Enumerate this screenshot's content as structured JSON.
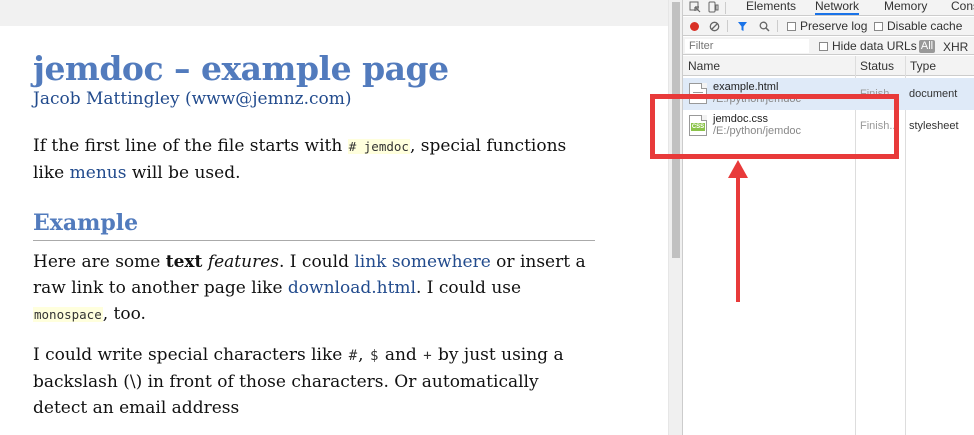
{
  "page": {
    "title": "jemdoc – example page",
    "author": "Jacob Mattingley",
    "author_email_open": "(",
    "author_email": "www@jemnz.com",
    "author_email_close": ")",
    "intro": {
      "t1": "If the first line of the file starts with ",
      "code": "# jemdoc",
      "t2": ", special functions",
      "t3": "like ",
      "link": "menus",
      "t4": " will be used."
    },
    "section_heading": "Example",
    "para1": {
      "t1": "Here are some ",
      "bold": "text",
      "t2": " ",
      "italic": "features",
      "t3": ". I could ",
      "link1": "link somewhere",
      "t4": " or insert a",
      "t5": "raw link to another page like ",
      "link2": "download.html",
      "t6": ". I could use",
      "code": "monospace",
      "t7": ", too."
    },
    "para2": {
      "line1a": "I could write special characters like ",
      "c1": "#",
      "sep1": ", ",
      "c2": "$",
      "sep2": " and ",
      "c3": "+",
      "line1b": " by just using a",
      "line2": "backslash (\\) in front of those characters. Or automatically",
      "line3": "detect an email address"
    }
  },
  "devtools": {
    "tabs": [
      "Elements",
      "Network",
      "Memory",
      "Cons"
    ],
    "active_tab": "Network",
    "toolbar": {
      "preserve_log": "Preserve log",
      "disable_cache": "Disable cache"
    },
    "filter": {
      "placeholder": "Filter",
      "hide_data_urls": "Hide data URLs",
      "all": "All",
      "xhr": "XHR"
    },
    "columns": {
      "name": "Name",
      "status": "Status",
      "type": "Type"
    },
    "requests": [
      {
        "name": "example.html",
        "path": "/E:/python/jemdoc",
        "status": "Finish...",
        "type": "document"
      },
      {
        "name": "jemdoc.css",
        "path": "/E:/python/jemdoc",
        "status": "Finish...",
        "type": "stylesheet"
      }
    ]
  },
  "colors": {
    "heading": "#527bbd",
    "link": "#224b8d",
    "annotation": "#e83a3a"
  }
}
